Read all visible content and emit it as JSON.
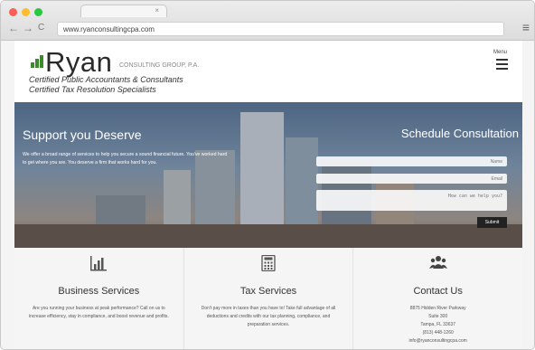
{
  "browser": {
    "url": "www.ryanconsultingcpa.com",
    "tab_close": "×",
    "back": "←",
    "forward": "→",
    "reload": "C",
    "menu": "≡",
    "traffic_colors": [
      "#fc5f57",
      "#fdbc2e",
      "#28c840"
    ]
  },
  "header": {
    "logo_word": "Ryan",
    "logo_subtitle": "CONSULTING GROUP, P.A.",
    "tagline_1": "Certified Public Accountants & Consultants",
    "tagline_2": "Certified Tax Resolution Specialists",
    "menu_label": "Menu",
    "logo_color": "#3b8a2b"
  },
  "hero": {
    "title": "Support you Deserve",
    "text": "We offer a broad range of services to help you secure a sound financial future. You've worked hard to get where you are. You deserve a firm that works hard for you.",
    "form_title": "Schedule Consultation",
    "fields": {
      "name_placeholder": "Name",
      "email_placeholder": "Email",
      "message_placeholder": "How can we help you?"
    },
    "submit_label": "Submit"
  },
  "services": [
    {
      "icon": "bar-chart-icon",
      "title": "Business Services",
      "text": "Are you running your business at peak performance? Call on us to increase efficiency, stay in compliance, and boost revenue and profits."
    },
    {
      "icon": "calculator-icon",
      "title": "Tax Services",
      "text": "Don't pay more in taxes than you have to! Take full advantage of all deductions and credits with our tax planning, compliance, and preparation services."
    },
    {
      "icon": "users-icon",
      "title": "Contact Us",
      "address_1": "8875 Hidden River Parkway",
      "address_2": "Suite 300",
      "address_3": "Tampa, FL 33637",
      "phone": "(813) 448-1260",
      "email": "info@ryanconsultingcpa.com"
    }
  ]
}
